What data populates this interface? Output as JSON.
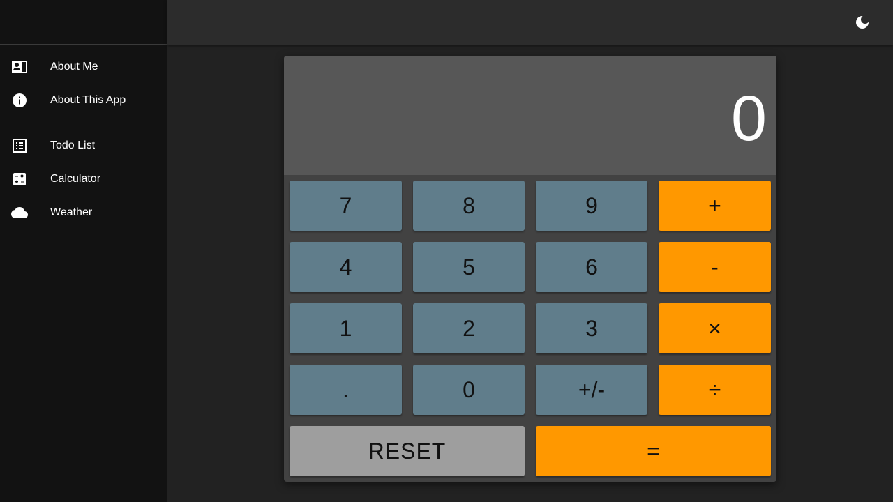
{
  "sidebar": {
    "group1": [
      {
        "label": "About Me",
        "icon": "contact-card-icon"
      },
      {
        "label": "About This App",
        "icon": "info-icon"
      }
    ],
    "group2": [
      {
        "label": "Todo List",
        "icon": "list-icon"
      },
      {
        "label": "Calculator",
        "icon": "calculator-icon"
      },
      {
        "label": "Weather",
        "icon": "cloud-icon"
      }
    ]
  },
  "appbar": {
    "theme_icon": "moon-icon"
  },
  "calculator": {
    "display": "0",
    "keys": {
      "seven": "7",
      "eight": "8",
      "nine": "9",
      "plus": "+",
      "four": "4",
      "five": "5",
      "six": "6",
      "minus": "-",
      "one": "1",
      "two": "2",
      "three": "3",
      "times": "×",
      "dot": ".",
      "zero": "0",
      "negate": "+/-",
      "divide": "÷",
      "reset": "RESET",
      "equals": "="
    }
  },
  "colors": {
    "number_key": "#607d8b",
    "operator_key": "#ff9800",
    "reset_key": "#9e9e9e",
    "display_bg": "#575757",
    "sidebar_bg": "#121212"
  }
}
